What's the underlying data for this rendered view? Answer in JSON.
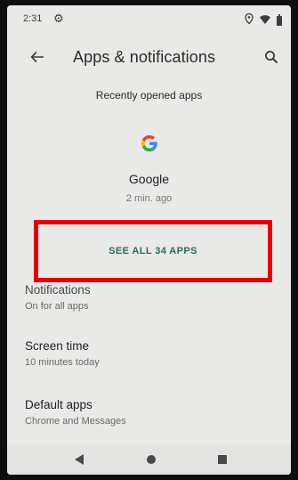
{
  "status_bar": {
    "time": "2:31",
    "gear_icon": "gear-icon",
    "location_icon": "location-icon",
    "wifi_icon": "wifi-icon",
    "battery_icon": "battery-icon"
  },
  "app_bar": {
    "title": "Apps & notifications",
    "back_icon": "arrow-back-icon",
    "search_icon": "search-icon"
  },
  "recent_apps": {
    "header": "Recently opened apps",
    "items": [
      {
        "name": "Google",
        "time": "2 min. ago",
        "icon": "google-icon"
      }
    ]
  },
  "see_all": {
    "label": "SEE ALL 34 APPS"
  },
  "settings": [
    {
      "title": "Notifications",
      "subtitle": "On for all apps"
    },
    {
      "title": "Screen time",
      "subtitle": "10 minutes today"
    },
    {
      "title": "Default apps",
      "subtitle": "Chrome and Messages"
    }
  ],
  "highlight_color": "#e00000",
  "accent_color": "#2d6a61"
}
